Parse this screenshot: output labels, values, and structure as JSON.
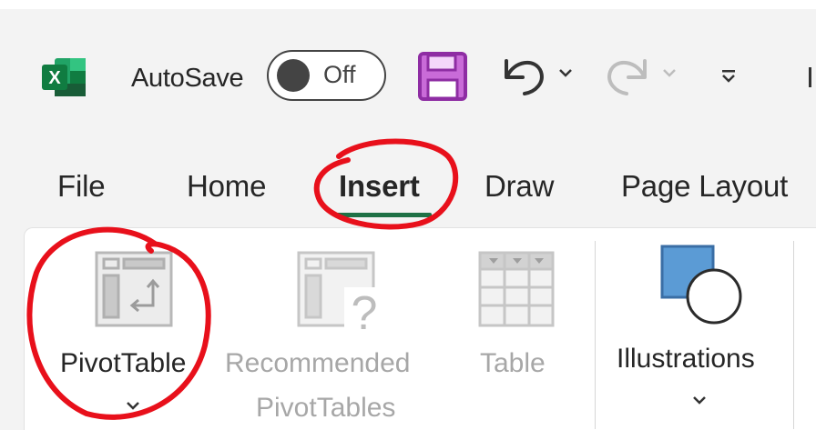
{
  "quick_access": {
    "app_icon": "excel-logo",
    "autosave_label": "AutoSave",
    "autosave_toggle_state": "Off",
    "icons": [
      "save-icon",
      "undo-icon",
      "undo-dropdown-chevron-icon",
      "redo-icon",
      "redo-dropdown-chevron-icon",
      "customize-qat-icon"
    ]
  },
  "tabs": [
    {
      "label": "File",
      "active": false
    },
    {
      "label": "Home",
      "active": false
    },
    {
      "label": "Insert",
      "active": true
    },
    {
      "label": "Draw",
      "active": false
    },
    {
      "label": "Page Layout",
      "active": false
    }
  ],
  "ribbon": {
    "pivottable": {
      "label": "PivotTable",
      "icon": "pivottable-icon",
      "enabled": true
    },
    "recommended": {
      "label_line1": "Recommended",
      "label_line2": "PivotTables",
      "icon": "recommended-pivottables-icon",
      "enabled": false
    },
    "table": {
      "label": "Table",
      "icon": "table-icon",
      "enabled": false
    },
    "illustrations": {
      "label": "Illustrations",
      "icon": "illustrations-shapes-icon",
      "enabled": true
    }
  },
  "colors": {
    "excel_green": "#1e7145",
    "active_tab_underline": "#1e7145",
    "save_icon_purple": "#b14fc5",
    "disabled_text": "#a7a7a7",
    "illustration_square": "#5b9bd5",
    "annotation_red": "#e8101b"
  }
}
